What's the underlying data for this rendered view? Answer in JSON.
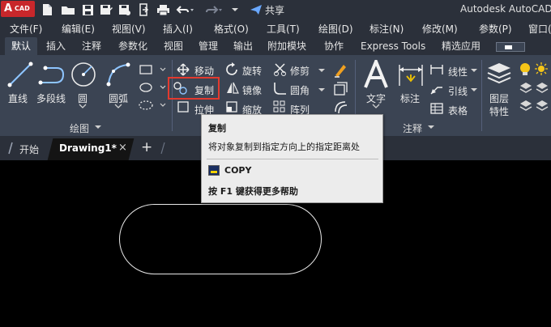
{
  "titlebar": {
    "logo_text": "A",
    "logo_sub": "CAD",
    "share_label": "共享",
    "app_title": "Autodesk AutoCAD"
  },
  "menu": [
    "文件(F)",
    "编辑(E)",
    "视图(V)",
    "插入(I)",
    "格式(O)",
    "工具(T)",
    "绘图(D)",
    "标注(N)",
    "修改(M)",
    "参数(P)",
    "窗口("
  ],
  "ribbon_tabs": [
    "默认",
    "插入",
    "注释",
    "参数化",
    "视图",
    "管理",
    "输出",
    "附加模块",
    "协作",
    "Express Tools",
    "精选应用"
  ],
  "draw_panel": {
    "line": "直线",
    "polyline": "多段线",
    "circle": "圆",
    "arc": "圆弧",
    "title": "绘图"
  },
  "modify_panel": {
    "move": "移动",
    "rotate": "旋转",
    "trim": "修剪",
    "copy": "复制",
    "mirror": "镜像",
    "fillet": "圆角",
    "stretch": "拉伸",
    "scale": "缩放",
    "array": "阵列"
  },
  "annotation_panel": {
    "text": "文字",
    "dimension": "标注",
    "linear": "线性",
    "leader": "引线",
    "table": "表格",
    "title": "注释"
  },
  "layers_panel": {
    "properties_line1": "图层",
    "properties_line2": "特性"
  },
  "file_tabs": {
    "start": "开始",
    "drawing": "Drawing1*",
    "close": "×",
    "new": "+"
  },
  "tooltip": {
    "title": "复制",
    "description": "将对象复制到指定方向上的指定距离处",
    "command": "COPY",
    "help": "按 F1 键获得更多帮助"
  },
  "colors": {
    "chrome": "#2b303a",
    "ribbon": "#3b4453",
    "canvas": "#000000",
    "logo_red": "#c8272b",
    "highlight_red": "#e33a2f",
    "tooltip_bg": "#ececec"
  }
}
